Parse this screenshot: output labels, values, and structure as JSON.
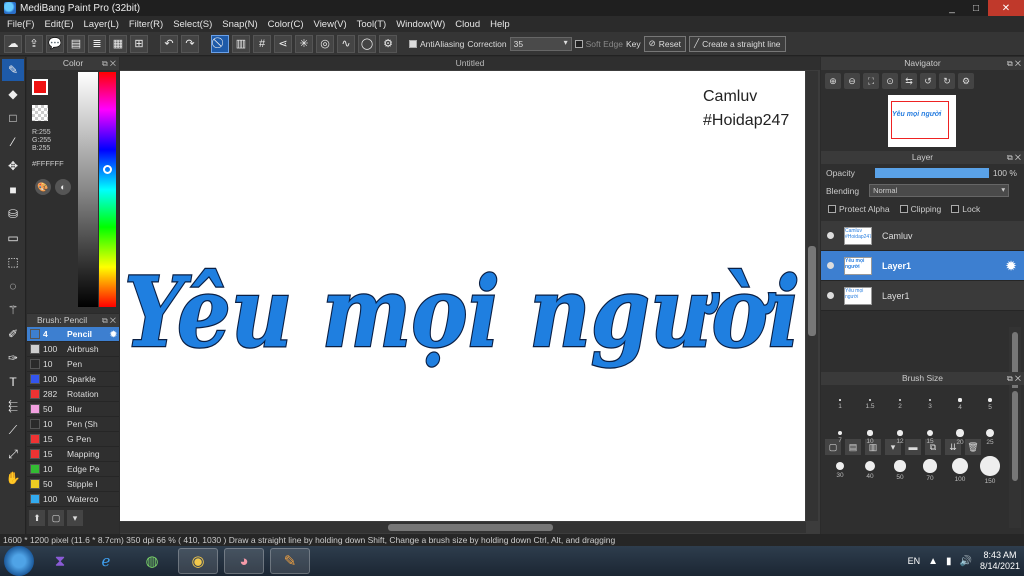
{
  "window": {
    "title": "MediBang Paint Pro (32bit)",
    "controls": [
      "_",
      "□",
      "✕"
    ]
  },
  "menu": [
    "File(F)",
    "Edit(E)",
    "Layer(L)",
    "Filter(R)",
    "Select(S)",
    "Snap(N)",
    "Color(C)",
    "View(V)",
    "Tool(T)",
    "Window(W)",
    "Cloud",
    "Help"
  ],
  "toolbar": {
    "antialiasing_label": "AntiAliasing",
    "correction_label": "Correction",
    "correction_value": "35",
    "soft_edge_label": "Soft Edge",
    "key_label": "Key",
    "reset_label": "Reset",
    "straight_line_label": "Create a straight line"
  },
  "color_panel": {
    "title": "Color",
    "r": "R:255",
    "g": "G:255",
    "b": "B:255",
    "hex": "#FFFFFF",
    "fg_color": "#ee1111"
  },
  "brush_panel": {
    "title": "Brush: Pencil",
    "brushes": [
      {
        "size": "4",
        "name": "Pencil",
        "color": "#3d7fd0",
        "selected": true
      },
      {
        "size": "100",
        "name": "Airbrush",
        "color": "#cfcfcf"
      },
      {
        "size": "10",
        "name": "Pen",
        "color": "#2a2a2a"
      },
      {
        "size": "100",
        "name": "Sparkle",
        "color": "#3355ee"
      },
      {
        "size": "282",
        "name": "Rotation",
        "color": "#ee3333"
      },
      {
        "size": "50",
        "name": "Blur",
        "color": "#f2a0e0"
      },
      {
        "size": "10",
        "name": "Pen (Sh",
        "color": "#2a2a2a"
      },
      {
        "size": "15",
        "name": "G Pen",
        "color": "#ee3333"
      },
      {
        "size": "15",
        "name": "Mapping",
        "color": "#ee3333"
      },
      {
        "size": "10",
        "name": "Edge Pe",
        "color": "#33bb33"
      },
      {
        "size": "50",
        "name": "Stipple I",
        "color": "#eecc22"
      },
      {
        "size": "100",
        "name": "Waterco",
        "color": "#33aaee"
      }
    ]
  },
  "canvas": {
    "tab_title": "Untitled",
    "watermark_line1": "Camluv",
    "watermark_line2": "#Hoidap247",
    "script_text": "Yêu mọi người",
    "ink_color": "#1f7fe0"
  },
  "navigator": {
    "title": "Navigator",
    "thumb_text": "Yêu mọi người"
  },
  "layer_panel": {
    "title": "Layer",
    "opacity_label": "Opacity",
    "opacity_value": "100 %",
    "opacity_fraction": 1.0,
    "blending_label": "Blending",
    "blending_value": "Normal",
    "protect_alpha_label": "Protect Alpha",
    "clipping_label": "Clipping",
    "lock_label": "Lock",
    "layers": [
      {
        "name": "Camluv",
        "thumb": "Camluv #Hoidap247",
        "selected": false
      },
      {
        "name": "Layer1",
        "thumb": "Yêu mọi người",
        "selected": true
      },
      {
        "name": "Layer1",
        "thumb": "Yêu mọi người",
        "selected": false
      }
    ]
  },
  "brush_size_panel": {
    "title": "Brush Size",
    "sizes": [
      "1",
      "1.5",
      "2",
      "3",
      "4",
      "5",
      "7",
      "10",
      "12",
      "15",
      "20",
      "25",
      "30",
      "40",
      "50",
      "70",
      "100",
      "150"
    ]
  },
  "status": {
    "text": "1600 * 1200 pixel  (11.6 * 8.7cm)  350 dpi  66 %  ( 410, 1030 )  Draw a straight line by holding down Shift, Change a brush size by holding down Ctrl, Alt, and dragging"
  },
  "taskbar": {
    "lang": "EN",
    "time": "8:43 AM",
    "date": "8/14/2021"
  }
}
